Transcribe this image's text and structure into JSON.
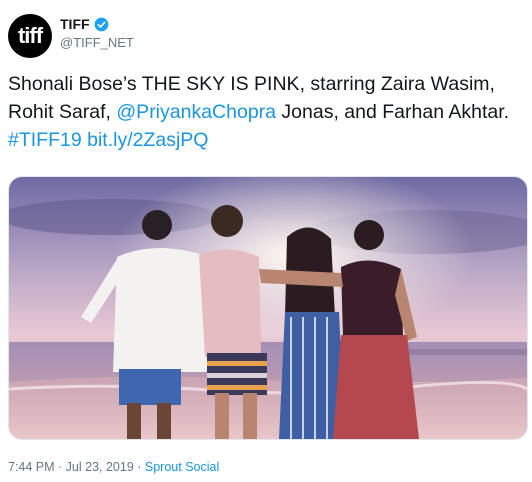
{
  "account": {
    "avatar_text": "tiff",
    "display_name": "TIFF",
    "handle": "@TIFF_NET",
    "verified_icon": "verified-badge-icon"
  },
  "tweet": {
    "text_part1": "Shonali Bose’s THE SKY IS PINK, starring Zaira Wasim, Rohit Saraf, ",
    "mention": "@PriyankaChopra",
    "text_part2": " Jonas, and Farhan Akhtar. ",
    "hashtag": "#TIFF19",
    "space": " ",
    "url": "bit.ly/2ZasjPQ"
  },
  "media": {
    "description_icon": "photo-four-people-beach-sunset"
  },
  "meta": {
    "time": "7:44 PM",
    "separator1": " · ",
    "date": "Jul 23, 2019",
    "separator2": " · ",
    "source": "Sprout Social"
  },
  "colors": {
    "link": "#1b95e0",
    "muted": "#657786",
    "text": "#14171a"
  }
}
